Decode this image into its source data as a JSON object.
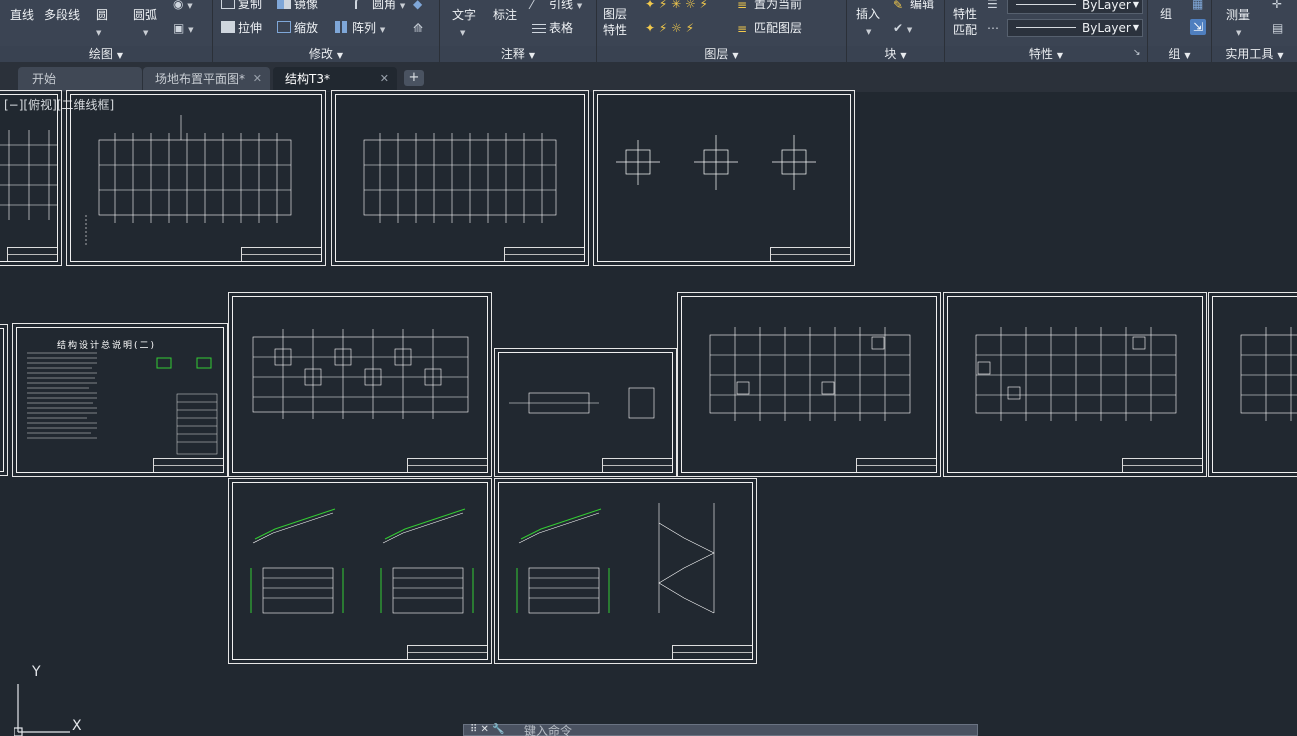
{
  "ribbon": {
    "draw": {
      "title": "绘图",
      "line": "直线",
      "polyline": "多段线",
      "circle": "圆",
      "arc": "圆弧"
    },
    "modify": {
      "title": "修改",
      "copy": "复制",
      "mirror": "镜像",
      "fillet": "圆角",
      "stretch": "拉伸",
      "scale": "缩放",
      "array": "阵列"
    },
    "annotation": {
      "title": "注释",
      "text": "文字",
      "dimension": "标注",
      "leader": "引线",
      "table": "表格"
    },
    "layers": {
      "title": "图层",
      "layer_props_1": "图层",
      "layer_props_2": "特性",
      "set_current": "置为当前",
      "match_layer": "匹配图层"
    },
    "block": {
      "title": "块",
      "insert": "插入",
      "edit": "编辑"
    },
    "properties": {
      "title": "特性",
      "match_1": "特性",
      "match_2": "匹配",
      "linetype": "ByLayer",
      "lineweight": "ByLayer"
    },
    "groups": {
      "title": "组",
      "group": "组"
    },
    "utilities": {
      "title": "实用工具",
      "measure": "测量"
    }
  },
  "tabs": [
    {
      "label": "开始"
    },
    {
      "label": "场地布置平面图*"
    },
    {
      "label": "结构T3*"
    }
  ],
  "tab_add": "+",
  "canvas": {
    "viewport_label": "[−][俯视][二维线框]",
    "sheet_heading": "结构设计总说明(二)"
  },
  "ucs": {
    "y": "Y",
    "x": "X"
  },
  "command": {
    "prompt": "键入命令"
  },
  "colors": {
    "background": "#212830",
    "ribbon": "#3b4453",
    "sheet_line": "#ffffff",
    "rebar": "#33cc33"
  }
}
